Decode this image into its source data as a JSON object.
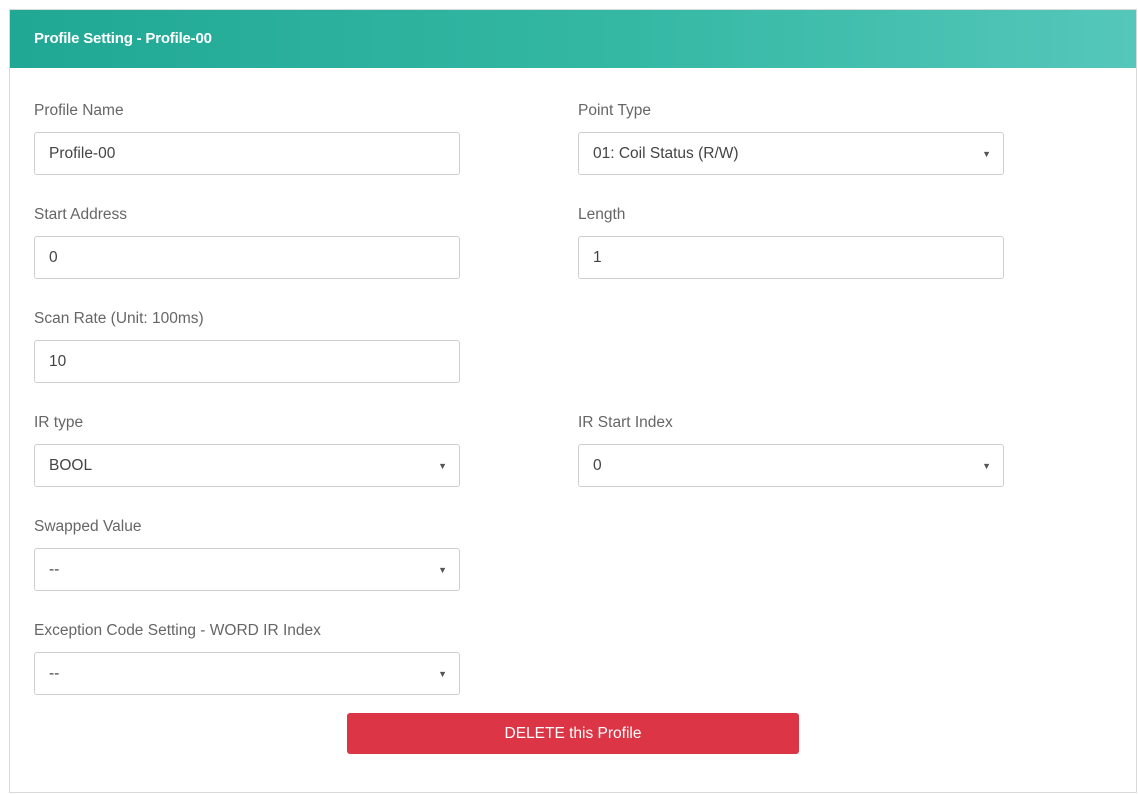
{
  "panel": {
    "title": "Profile Setting - Profile-00"
  },
  "form": {
    "profile_name": {
      "label": "Profile Name",
      "value": "Profile-00"
    },
    "point_type": {
      "label": "Point Type",
      "value": "01: Coil Status (R/W)"
    },
    "start_address": {
      "label": "Start Address",
      "value": "0"
    },
    "length": {
      "label": "Length",
      "value": "1"
    },
    "scan_rate": {
      "label": "Scan Rate (Unit: 100ms)",
      "value": "10"
    },
    "ir_type": {
      "label": "IR type",
      "value": "BOOL"
    },
    "ir_start_index": {
      "label": "IR Start Index",
      "value": "0"
    },
    "swapped_value": {
      "label": "Swapped Value",
      "value": "--"
    },
    "exception_code": {
      "label": "Exception Code Setting - WORD IR Index",
      "value": "--"
    }
  },
  "actions": {
    "delete_label": "DELETE this Profile"
  },
  "colors": {
    "header_start": "#20a894",
    "header_end": "#55c7ba",
    "delete_button": "#dc3545"
  },
  "icons": {
    "select_caret": "caret-down-icon"
  }
}
